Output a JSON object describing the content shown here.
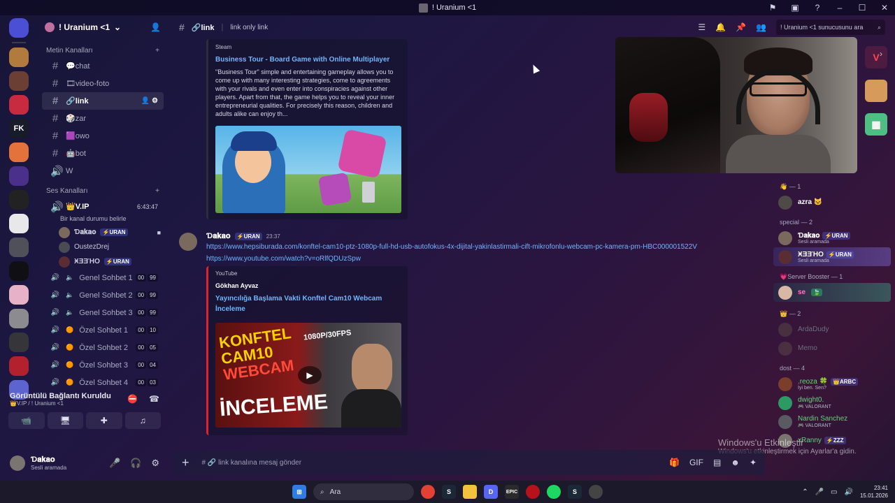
{
  "window": {
    "title": "! Uranium <1"
  },
  "guilds": [
    {
      "label": "",
      "color": "#4b4fd6",
      "icon": "discord-home-icon"
    },
    {
      "label": "",
      "color": "#b07b3c",
      "icon": "server-avatar"
    },
    {
      "label": "",
      "color": "#6b3f34",
      "icon": "server-avatar"
    },
    {
      "label": "",
      "color": "#c82b3f",
      "icon": "server-avatar"
    },
    {
      "label": "FK",
      "color": "#171b2a",
      "icon": "server-avatar"
    },
    {
      "label": "",
      "color": "#e3733a",
      "icon": "server-avatar"
    },
    {
      "label": "",
      "color": "#4a2f8b",
      "icon": "server-avatar"
    },
    {
      "label": "",
      "color": "#222",
      "icon": "server-avatar"
    },
    {
      "label": "",
      "color": "#e8e8ea",
      "icon": "server-avatar"
    },
    {
      "label": "",
      "color": "#50505b",
      "icon": "server-avatar"
    },
    {
      "label": "",
      "color": "#101014",
      "icon": "server-avatar"
    },
    {
      "label": "",
      "color": "#e7b2c8",
      "icon": "server-avatar"
    },
    {
      "label": "",
      "color": "#8b8b90",
      "icon": "server-avatar"
    },
    {
      "label": "",
      "color": "#35353a",
      "icon": "server-avatar"
    },
    {
      "label": "",
      "color": "#b3202e",
      "icon": "server-avatar"
    },
    {
      "label": "",
      "color": "#5e64cf",
      "icon": "server-avatar"
    }
  ],
  "server": {
    "name": "! Uranium <1"
  },
  "sidebar": {
    "text_category": "Metin Kanalları",
    "text_channels": [
      "💬chat",
      "🎞video-foto",
      "🔗link",
      "🎲zar",
      "🟪owo",
      "🤖bot",
      "W"
    ],
    "voice_category": "Ses Kanalları",
    "vip": {
      "name": "👑V.IP",
      "time": "6:43:47",
      "status": "Bir kanal durumu belirle"
    },
    "vip_users": [
      {
        "name": "Ɗ𝐚𝐤𝐚𝐨",
        "badge": "⚡URAN"
      },
      {
        "name": "OustezDrej",
        "badge": ""
      },
      {
        "name": "ӾƎƎΉO",
        "badge": "⚡URAN"
      }
    ],
    "voice_channels": [
      {
        "name": "Genel Sohbet 1",
        "a": "00",
        "b": "99"
      },
      {
        "name": "Genel Sohbet 2",
        "a": "00",
        "b": "99"
      },
      {
        "name": "Genel Sohbet 3",
        "a": "00",
        "b": "99"
      },
      {
        "name": "Özel Sohbet 1",
        "a": "00",
        "b": "10"
      },
      {
        "name": "Özel Sohbet 2",
        "a": "00",
        "b": "05"
      },
      {
        "name": "Özel Sohbet 3",
        "a": "00",
        "b": "04"
      },
      {
        "name": "Özel Sohbet 4",
        "a": "00",
        "b": "03"
      }
    ]
  },
  "voice_panel": {
    "status": "Görüntülü Bağlantı Kuruldu",
    "sub": "👑V.IP / ! Uranium <1"
  },
  "user_panel": {
    "name": "Ɗ𝐚𝐤𝐚𝐨",
    "status": "Sesli aramada"
  },
  "header": {
    "channel": "link",
    "topic": "link only link",
    "search_placeholder": "! Uranium <1 sunucusunu ara"
  },
  "embed1": {
    "provider": "Steam",
    "title": "Business Tour - Board Game with Online Multiplayer",
    "description": "\"Business Tour\" simple and entertaining gameplay allows you to come up with many interesting strategies, come to agreements with your rivals and even enter into conspiracies against other players. Apart from that, the game helps you to reveal your inner entrepreneurial qualities. For precisely this reason, children and adults alike can enjoy th..."
  },
  "message": {
    "author": "Ɗ𝐚𝐤𝐚𝐨",
    "badge": "⚡URAN",
    "time": "23:37",
    "link1": "https://www.hepsiburada.com/konftel-cam10-ptz-1080p-full-hd-usb-autofokus-4x-dijital-yakinlastirmali-cift-mikrofonlu-webcam-pc-kamera-pm-HBC000001522V",
    "link2": "https://www.youtube.com/watch?v=oRlfQDUzSpw"
  },
  "embed2": {
    "provider": "YouTube",
    "author": "Gökhan Ayvaz",
    "title": "Yayıncılığa Başlama Vakti Konftel Cam10 Webcam İnceleme",
    "thumb_line1": "KONFTEL",
    "thumb_line2": "CAM10",
    "thumb_line3": "WEBCAM",
    "thumb_line4": "İNCELEME",
    "thumb_tag": "1080P/30FPS"
  },
  "members": {
    "g1": "👋 — 1",
    "azra": "azra 🐱",
    "g2": "special — 2",
    "special": [
      {
        "name": "Ɗ𝐚𝐤𝐚𝐨",
        "badge": "⚡URAN",
        "sub": "Sesli aramada"
      },
      {
        "name": "ӾƎƎΉO",
        "badge": "⚡URAN",
        "sub": "Sesli aramada"
      }
    ],
    "g3": "💗Server Booster — 1",
    "booster": "se",
    "g4": "👑 — 2",
    "offline": [
      "ArdaDudy",
      "Memo"
    ],
    "g5": "dost — 4",
    "dost": [
      {
        "name": ".reoza 🍀",
        "badge": "👑ARBC",
        "sub": "İyi ben. Sen?"
      },
      {
        "name": "dwight0.",
        "badge": "",
        "sub": "🎮 VALORANT"
      },
      {
        "name": "Nardin Sanchez",
        "badge": "",
        "sub": "🎮 VALORANT"
      },
      {
        "name": "xRanny",
        "badge": "⚡ZZZ",
        "sub": ""
      }
    ]
  },
  "composer": {
    "placeholder": "# 🔗 link kanalına mesaj gönder"
  },
  "windows": {
    "activate1": "Windows'u Etkinleştir",
    "activate2": "Windows'u etkinleştirmek için Ayarlar'a gidin."
  },
  "taskbar": {
    "search": "Ara",
    "time": "23:41",
    "date": "15.01.2026"
  }
}
